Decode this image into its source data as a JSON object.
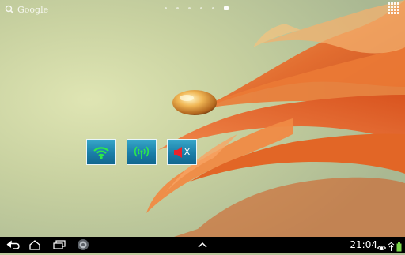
{
  "search": {
    "label": "Google"
  },
  "pager": {
    "count": 6,
    "current_index": 5
  },
  "widgets": [
    {
      "name": "wifi-toggle",
      "icon": "wifi-icon",
      "color": "#2ee84a"
    },
    {
      "name": "mobile-data-toggle",
      "icon": "antenna-icon",
      "color": "#2ee84a"
    },
    {
      "name": "sound-toggle",
      "icon": "speaker-muted-icon",
      "color": "#e8232a",
      "label": "X"
    }
  ],
  "navbar": {
    "buttons": [
      "back",
      "home",
      "recent-apps",
      "screenshot",
      "menu-up"
    ],
    "clock": "21:04",
    "status_icons": [
      "eye-icon",
      "signal-icon",
      "battery-icon"
    ]
  },
  "colors": {
    "widget_fill": "#1a7ea8",
    "petal": "#e4682a",
    "navbar": "#000000"
  }
}
